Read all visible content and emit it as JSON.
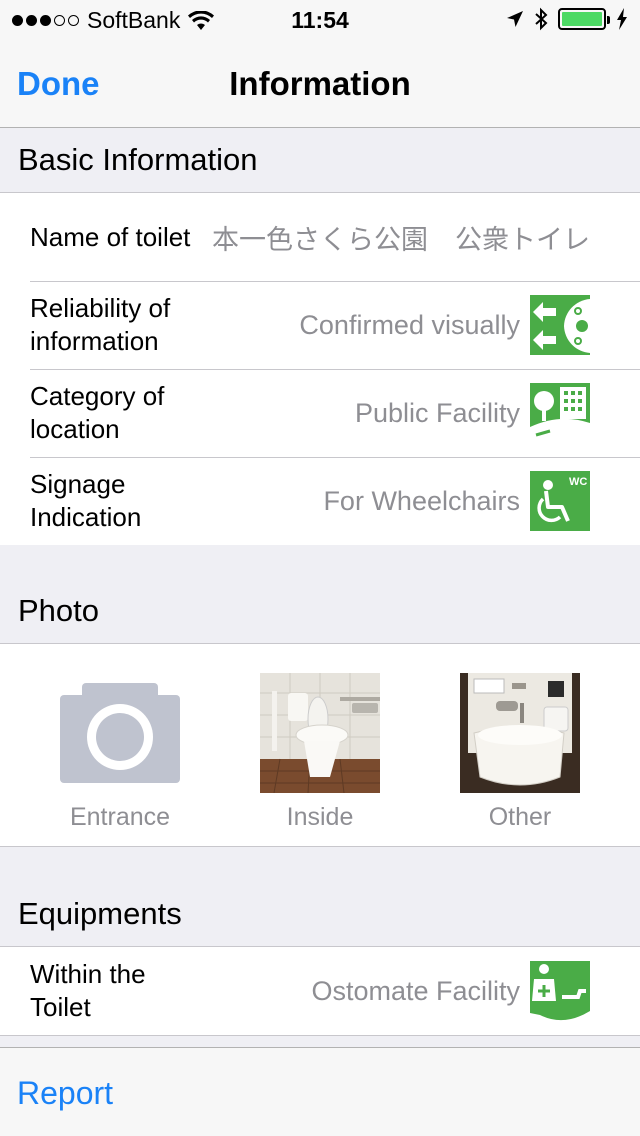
{
  "status_bar": {
    "carrier": "SoftBank",
    "time": "11:54",
    "signal_full": 3,
    "signal_total": 5,
    "battery_color": "#4cd964"
  },
  "nav": {
    "done_label": "Done",
    "title": "Information"
  },
  "sections": {
    "basic": {
      "title": "Basic Information",
      "rows": [
        {
          "label": "Name of toilet",
          "value": "本一色さくら公園　公衆トイレ",
          "icon": ""
        },
        {
          "label": "Reliability of information",
          "value": "Confirmed visually",
          "icon": "confirmed-visually-icon"
        },
        {
          "label": "Category of location",
          "value": "Public Facility",
          "icon": "public-facility-icon"
        },
        {
          "label": "Signage Indication",
          "value": "For Wheelchairs",
          "icon": "wheelchair-wc-icon"
        }
      ]
    },
    "photo": {
      "title": "Photo",
      "items": [
        {
          "caption": "Entrance",
          "image": "camera-placeholder-icon"
        },
        {
          "caption": "Inside",
          "image": "toilet-inside-photo"
        },
        {
          "caption": "Other",
          "image": "washbasin-photo"
        }
      ]
    },
    "equipments": {
      "title": "Equipments",
      "rows": [
        {
          "label": "Within the Toilet",
          "value": "Ostomate Facility",
          "icon": "ostomate-icon"
        }
      ]
    }
  },
  "toolbar": {
    "report_label": "Report"
  },
  "colors": {
    "accent": "#1a82f7",
    "icon_green": "#4aac47",
    "secondary_text": "#8e8e93"
  }
}
